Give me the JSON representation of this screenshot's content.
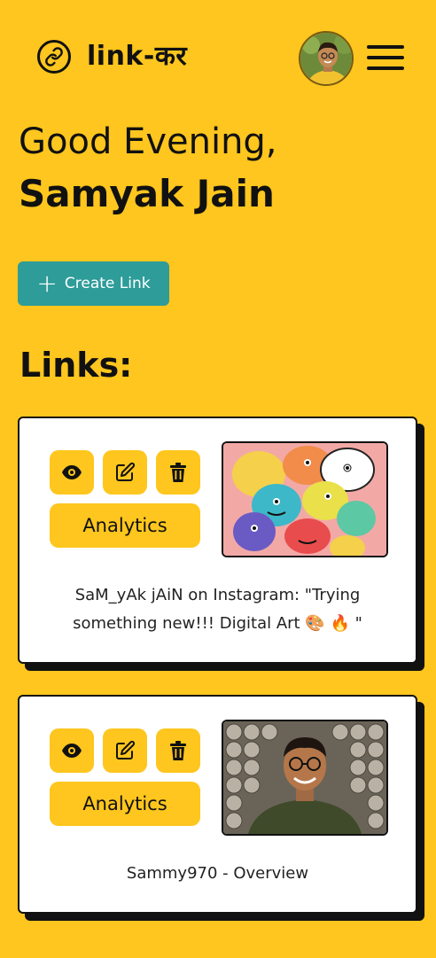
{
  "header": {
    "logo_text": "link-कर",
    "logo_icon": "link-icon",
    "avatar_alt": "user avatar",
    "menu_icon": "hamburger-menu-icon"
  },
  "greeting": {
    "salutation": "Good Evening,",
    "name": "Samyak Jain"
  },
  "actions": {
    "create_label": "Create Link"
  },
  "links_section": {
    "title": "Links:"
  },
  "links": [
    {
      "title": "SaM_yAk jAiN on Instagram: \"Trying something new!!! Digital Art 🎨 🔥 \"",
      "analytics_label": "Analytics",
      "thumbnail": "digital-art-doodle-image"
    },
    {
      "title": "Sammy970 - Overview",
      "analytics_label": "Analytics",
      "thumbnail": "profile-photo-image"
    }
  ],
  "colors": {
    "background": "#FEC61E",
    "accent": "#2E9C99",
    "card": "#FFFFFF",
    "ink": "#111111"
  }
}
